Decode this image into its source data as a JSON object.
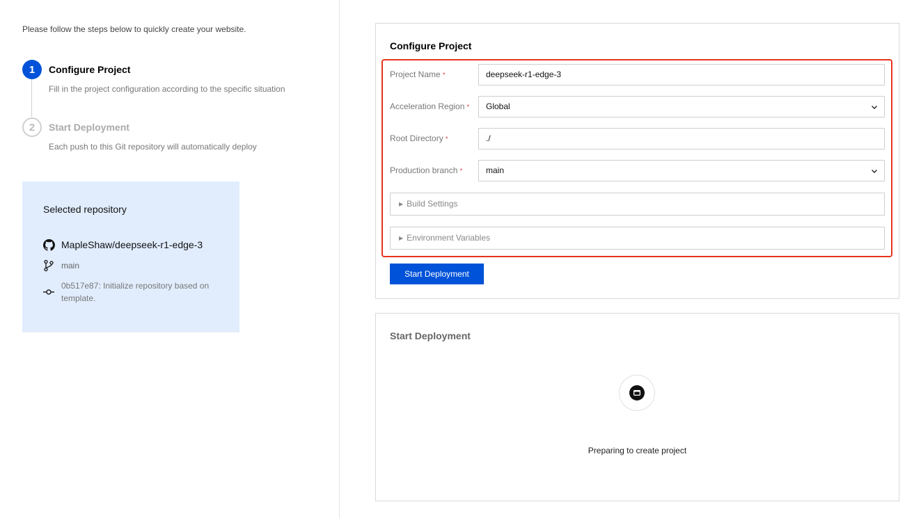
{
  "intro": "Please follow the steps below to quickly create your website.",
  "steps": [
    {
      "number": "1",
      "title": "Configure Project",
      "desc": "Fill in the project configuration according to the specific situation",
      "state": "active"
    },
    {
      "number": "2",
      "title": "Start Deployment",
      "desc": "Each push to this Git repository will automatically deploy",
      "state": "inactive"
    }
  ],
  "repo": {
    "title": "Selected repository",
    "name": "MapleShaw/deepseek-r1-edge-3",
    "branch": "main",
    "commit": "0b517e87: Initialize repository based on template.",
    "icons": {
      "repo": "github-icon",
      "branch": "git-branch-icon",
      "commit": "git-commit-icon"
    }
  },
  "configure": {
    "title": "Configure Project",
    "required_mark": "*",
    "fields": {
      "project_name": {
        "label": "Project Name",
        "value": "deepseek-r1-edge-3"
      },
      "region": {
        "label": "Acceleration Region",
        "value": "Global"
      },
      "root_dir": {
        "label": "Root Directory",
        "value": "./"
      },
      "branch": {
        "label": "Production branch",
        "value": "main"
      }
    },
    "build_settings": "Build Settings",
    "env_vars": "Environment Variables",
    "submit": "Start Deployment",
    "highlight_color": "#e8341c",
    "accent": "#0052d9"
  },
  "deployment": {
    "title": "Start Deployment",
    "status": "Preparing to create project",
    "icon": "window-icon"
  }
}
